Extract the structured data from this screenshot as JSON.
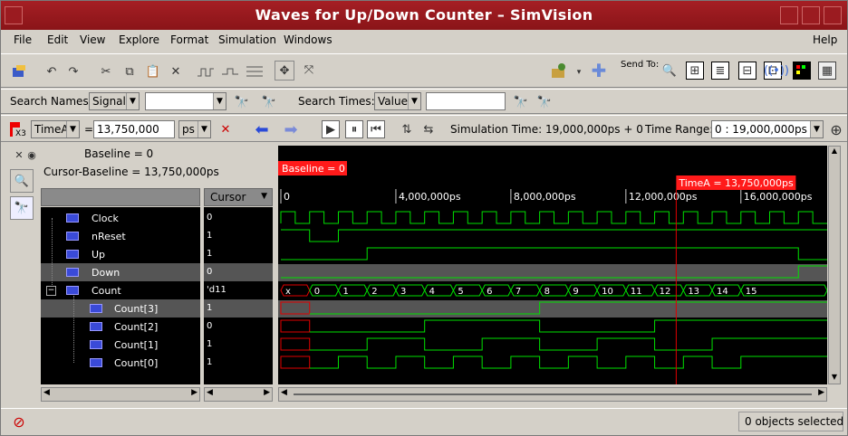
{
  "window": {
    "title": "Waves for Up/Down Counter – SimVision"
  },
  "menu": [
    "File",
    "Edit",
    "View",
    "Explore",
    "Format",
    "Simulation",
    "Windows",
    "Help"
  ],
  "toolbar": {
    "send_to_label": "Send To:"
  },
  "search": {
    "names_label": "Search Names:",
    "names_type": "Signal",
    "names_value": "",
    "times_label": "Search Times:",
    "times_type": "Value",
    "times_value": ""
  },
  "cursorbar": {
    "marker_count": "X3",
    "cursor_name": "TimeA",
    "equals": "=",
    "cursor_value": "13,750,000",
    "unit": "ps",
    "sim_time": "Simulation Time: 19,000,000ps + 0",
    "time_range_label": "Time Range:",
    "time_range_value": "0 : 19,000,000ps"
  },
  "panel": {
    "baseline": "Baseline = 0",
    "cursor_baseline": "Cursor-Baseline = 13,750,000ps",
    "cursor_column": "Cursor"
  },
  "signals": [
    {
      "name": "Clock",
      "value": "0",
      "indent": 1
    },
    {
      "name": "nReset",
      "value": "1",
      "indent": 1
    },
    {
      "name": "Up",
      "value": "1",
      "indent": 1
    },
    {
      "name": "Down",
      "value": "0",
      "indent": 1
    },
    {
      "name": "Count",
      "value": "'d11",
      "indent": 1
    },
    {
      "name": "Count[3]",
      "value": "1",
      "indent": 2
    },
    {
      "name": "Count[2]",
      "value": "0",
      "indent": 2
    },
    {
      "name": "Count[1]",
      "value": "1",
      "indent": 2
    },
    {
      "name": "Count[0]",
      "value": "1",
      "indent": 2
    }
  ],
  "waveform": {
    "baseline_marker": "Baseline = 0",
    "cursor_marker": "TimeA = 13,750,000ps",
    "cursor_time_ps": 13750000,
    "time_end_ps": 19000000,
    "ticks": [
      "0",
      "4,000,000ps",
      "8,000,000ps",
      "12,000,000ps",
      "16,000,000ps"
    ],
    "count_labels": [
      "x",
      "0",
      "1",
      "2",
      "3",
      "4",
      "5",
      "6",
      "7",
      "8",
      "9",
      "10",
      "11",
      "12",
      "13",
      "14",
      "15"
    ]
  },
  "status": {
    "selection": "0 objects selected"
  },
  "colors": {
    "title_bg": "#9b1a1f",
    "wave_green": "#00e000",
    "cursor_red": "#e00000",
    "marker_red": "#ff1a1a"
  }
}
